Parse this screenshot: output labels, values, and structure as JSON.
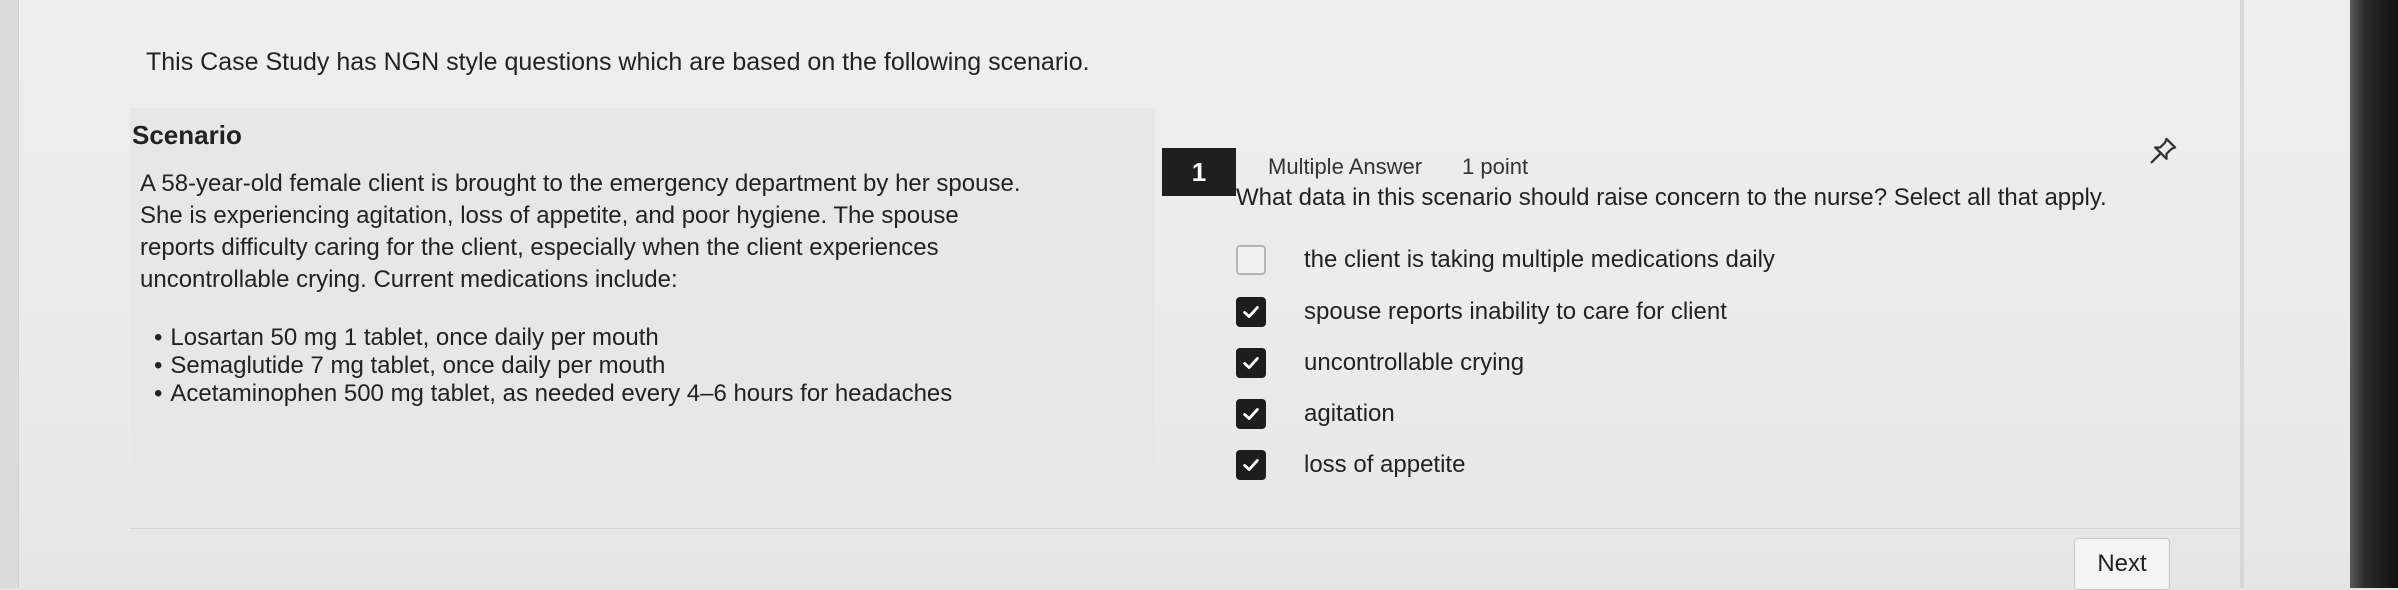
{
  "intro": "This Case Study has NGN style questions which are based on the following scenario.",
  "scenario": {
    "title": "Scenario",
    "text": "A 58-year-old female client is brought to the emergency department by her spouse. She is experiencing agitation, loss of appetite, and poor hygiene. The spouse reports difficulty caring for the client, especially when the client experiences uncontrollable crying. Current medications include:",
    "medications": [
      "Losartan 50 mg 1 tablet, once daily per mouth",
      "Semaglutide 7 mg tablet, once daily per mouth",
      "Acetaminophen 500 mg tablet, as needed every 4–6 hours for headaches"
    ]
  },
  "question": {
    "number": "1",
    "type": "Multiple Answer",
    "points": "1 point",
    "text": "What data in this scenario should raise concern to the nurse? Select all that apply.",
    "options": [
      {
        "label": "the client is taking multiple medications daily",
        "checked": false
      },
      {
        "label": "spouse reports inability to care for client",
        "checked": true
      },
      {
        "label": "uncontrollable crying",
        "checked": true
      },
      {
        "label": "agitation",
        "checked": true
      },
      {
        "label": "loss of appetite",
        "checked": true
      }
    ]
  },
  "navigation": {
    "next_label": "Next"
  },
  "icons": {
    "pin": "pin-icon",
    "check": "check-icon"
  }
}
